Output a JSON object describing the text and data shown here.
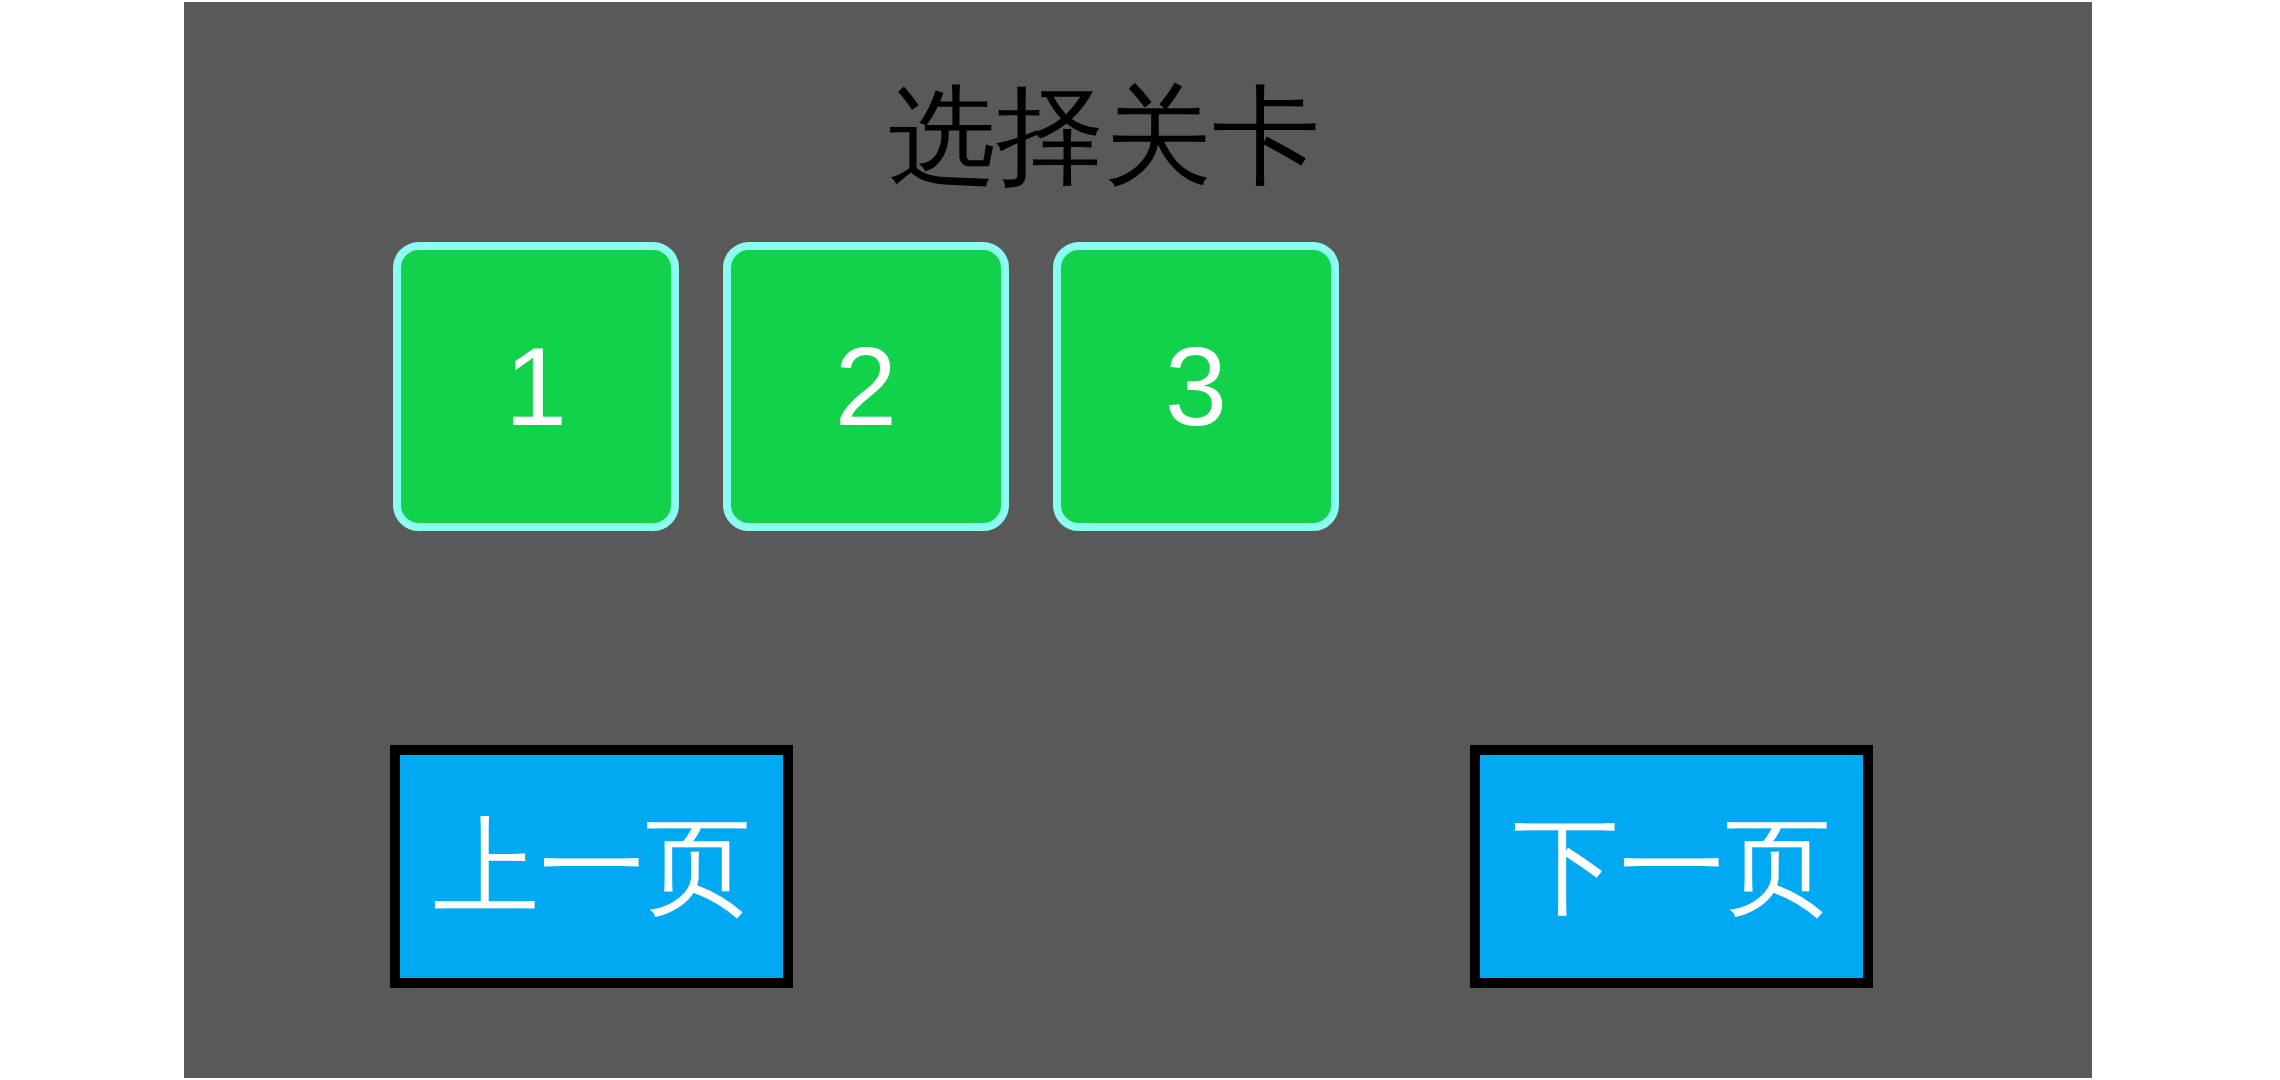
{
  "title": "选择关卡",
  "levels": [
    {
      "label": "1"
    },
    {
      "label": "2"
    },
    {
      "label": "3"
    }
  ],
  "nav_buttons": [
    {
      "kind": "previous",
      "label": "上一页"
    },
    {
      "kind": "next",
      "label": "下一页"
    }
  ]
}
